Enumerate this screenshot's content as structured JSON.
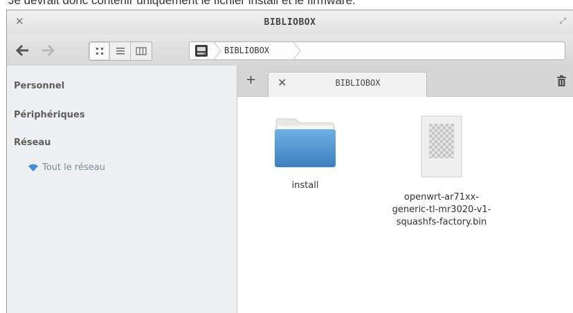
{
  "caption_fragment": "Je devrait donc contenir uniquement le fichier install et le firmware.",
  "window": {
    "title": "BIBLIOBOX"
  },
  "pathbar": {
    "crumb": "BIBLIOBOX"
  },
  "sidebar": {
    "sections": [
      {
        "label": "Personnel"
      },
      {
        "label": "Périphériques"
      },
      {
        "label": "Réseau"
      }
    ],
    "network_item": "Tout le réseau"
  },
  "tabs": [
    {
      "label": "BIBLIOBOX"
    }
  ],
  "files": [
    {
      "name": "install",
      "icon": "folder-icon"
    },
    {
      "name_lines": [
        "openwrt-ar71xx-",
        "generic-tl-mr3020-v1-",
        "squashfs-factory.bin"
      ],
      "icon": "binary-file-icon"
    }
  ],
  "colors": {
    "folder": "#4a90c8",
    "accent_wifi": "#3f8fd8"
  }
}
